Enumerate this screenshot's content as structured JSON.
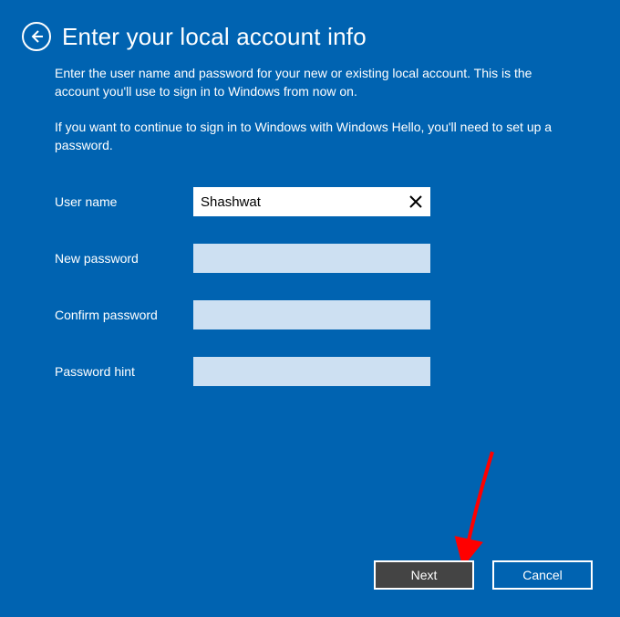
{
  "header": {
    "title": "Enter your local account info"
  },
  "description": {
    "p1": "Enter the user name and password for your new or existing local account. This is the account you'll use to sign in to Windows from now on.",
    "p2": "If you want to continue to sign in to Windows with Windows Hello, you'll need to set up a password."
  },
  "form": {
    "username": {
      "label": "User name",
      "value": "Shashwat"
    },
    "newPassword": {
      "label": "New password",
      "value": ""
    },
    "confirmPassword": {
      "label": "Confirm password",
      "value": ""
    },
    "passwordHint": {
      "label": "Password hint",
      "value": ""
    }
  },
  "footer": {
    "next": "Next",
    "cancel": "Cancel"
  }
}
